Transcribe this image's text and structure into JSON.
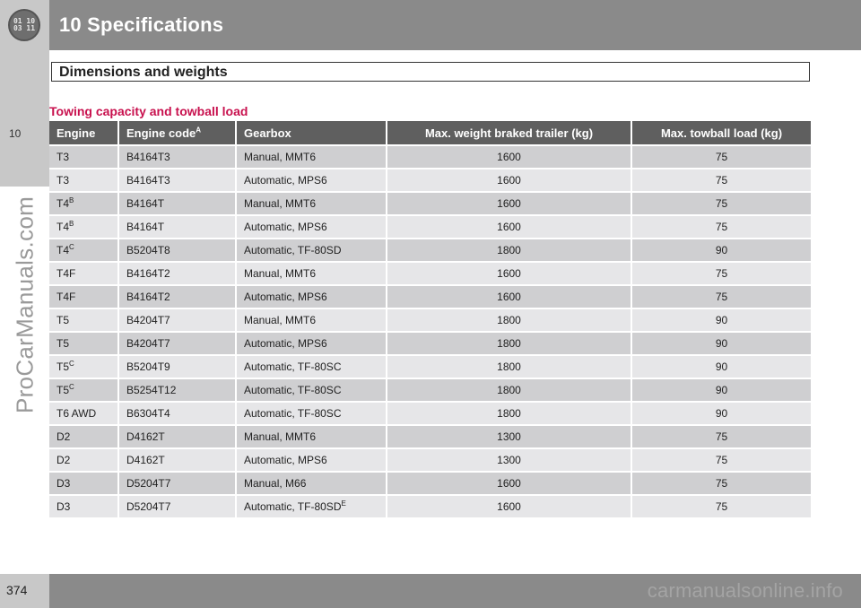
{
  "header": {
    "badge_text": "01 10\n03 11",
    "chapter_title": "10 Specifications"
  },
  "side": {
    "chapter_number": "10",
    "watermark": "ProCarManuals.com"
  },
  "section": {
    "title": "Dimensions and weights",
    "table_title": "Towing capacity and towball load"
  },
  "table": {
    "headers": {
      "engine": "Engine",
      "engine_code": "Engine code",
      "engine_code_note": "A",
      "gearbox": "Gearbox",
      "max_trailer": "Max. weight braked trailer (kg)",
      "max_towball": "Max. towball load (kg)"
    },
    "rows": [
      {
        "engine": "T3",
        "note": "",
        "code": "B4164T3",
        "gearbox": "Manual, MMT6",
        "gearbox_note": "",
        "trailer": "1600",
        "towball": "75"
      },
      {
        "engine": "T3",
        "note": "",
        "code": "B4164T3",
        "gearbox": "Automatic, MPS6",
        "gearbox_note": "",
        "trailer": "1600",
        "towball": "75"
      },
      {
        "engine": "T4",
        "note": "B",
        "code": "B4164T",
        "gearbox": "Manual, MMT6",
        "gearbox_note": "",
        "trailer": "1600",
        "towball": "75"
      },
      {
        "engine": "T4",
        "note": "B",
        "code": "B4164T",
        "gearbox": "Automatic, MPS6",
        "gearbox_note": "",
        "trailer": "1600",
        "towball": "75"
      },
      {
        "engine": "T4",
        "note": "C",
        "code": "B5204T8",
        "gearbox": "Automatic, TF-80SD",
        "gearbox_note": "",
        "trailer": "1800",
        "towball": "90"
      },
      {
        "engine": "T4F",
        "note": "",
        "code": "B4164T2",
        "gearbox": "Manual, MMT6",
        "gearbox_note": "",
        "trailer": "1600",
        "towball": "75"
      },
      {
        "engine": "T4F",
        "note": "",
        "code": "B4164T2",
        "gearbox": "Automatic, MPS6",
        "gearbox_note": "",
        "trailer": "1600",
        "towball": "75"
      },
      {
        "engine": "T5",
        "note": "",
        "code": "B4204T7",
        "gearbox": "Manual, MMT6",
        "gearbox_note": "",
        "trailer": "1800",
        "towball": "90"
      },
      {
        "engine": "T5",
        "note": "",
        "code": "B4204T7",
        "gearbox": "Automatic, MPS6",
        "gearbox_note": "",
        "trailer": "1800",
        "towball": "90"
      },
      {
        "engine": "T5",
        "note": "C",
        "code": "B5204T9",
        "gearbox": "Automatic, TF-80SC",
        "gearbox_note": "",
        "trailer": "1800",
        "towball": "90"
      },
      {
        "engine": "T5",
        "note": "C",
        "code": "B5254T12",
        "gearbox": "Automatic, TF-80SC",
        "gearbox_note": "",
        "trailer": "1800",
        "towball": "90"
      },
      {
        "engine": "T6 AWD",
        "note": "",
        "code": "B6304T4",
        "gearbox": "Automatic, TF-80SC",
        "gearbox_note": "",
        "trailer": "1800",
        "towball": "90"
      },
      {
        "engine": "D2",
        "note": "",
        "code": "D4162T",
        "gearbox": "Manual, MMT6",
        "gearbox_note": "",
        "trailer": "1300",
        "towball": "75"
      },
      {
        "engine": "D2",
        "note": "",
        "code": "D4162T",
        "gearbox": "Automatic, MPS6",
        "gearbox_note": "",
        "trailer": "1300",
        "towball": "75"
      },
      {
        "engine": "D3",
        "note": "",
        "code": "D5204T7",
        "gearbox": "Manual, M66",
        "gearbox_note": "",
        "trailer": "1600",
        "towball": "75"
      },
      {
        "engine": "D3",
        "note": "",
        "code": "D5204T7",
        "gearbox": "Automatic, TF-80SD",
        "gearbox_note": "E",
        "trailer": "1600",
        "towball": "75"
      }
    ]
  },
  "footer": {
    "page_number": "374",
    "watermark": "carmanualsonline.info"
  },
  "colors": {
    "header_gray": "#8a8a8a",
    "light_gray": "#c8c8c8",
    "table_header": "#5f5f5f",
    "row_dark": "#cfcfd1",
    "row_light": "#e6e6e8",
    "accent_red": "#c8114e"
  }
}
